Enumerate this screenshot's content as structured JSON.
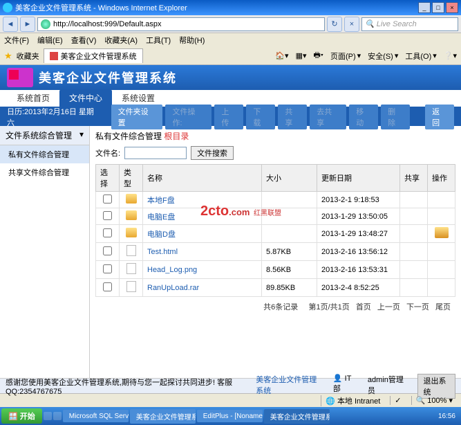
{
  "window": {
    "title": "美客企业文件管理系统 - Windows Internet Explorer",
    "url": "http://localhost:999/Default.aspx",
    "search_placeholder": "Live Search"
  },
  "ie_menu": [
    "文件(F)",
    "编辑(E)",
    "查看(V)",
    "收藏夹(A)",
    "工具(T)",
    "帮助(H)"
  ],
  "fav": {
    "label": "收藏夹",
    "tab": "美客企业文件管理系统",
    "right": [
      "",
      "页面(P)",
      "安全(S)",
      "工具(O)",
      ""
    ]
  },
  "app": {
    "title": "美客企业文件管理系统",
    "nav": [
      "系统首页",
      "文件中心",
      "系统设置"
    ],
    "nav_active": 1,
    "date": "日历:2013年2月16日 星期六",
    "actions": [
      "文件夹设置",
      "文件操作:",
      "上传",
      "下载",
      "共享",
      "去共享",
      "移动",
      "删除",
      "返回"
    ]
  },
  "sidebar": {
    "head": "文件系统综合管理",
    "items": [
      "私有文件综合管理",
      "共享文件综合管理"
    ],
    "sel": 0
  },
  "panel": {
    "title_a": "私有文件综合管理 ",
    "title_b": "根目录",
    "search_label": "文件名:",
    "search_btn": "文件搜索"
  },
  "table": {
    "cols": [
      "选择",
      "类型",
      "名称",
      "大小",
      "更新日期",
      "共享",
      "操作"
    ],
    "rows": [
      {
        "type": "folder",
        "name": "本地F盘",
        "size": "",
        "date": "2013-2-1 9:18:53",
        "share": "",
        "op": ""
      },
      {
        "type": "folder",
        "name": "电脑E盘",
        "size": "",
        "date": "2013-1-29 13:50:05",
        "share": "",
        "op": ""
      },
      {
        "type": "folder",
        "name": "电脑D盘",
        "size": "",
        "date": "2013-1-29 13:48:27",
        "share": "",
        "op": "open"
      },
      {
        "type": "file",
        "name": "Test.html",
        "size": "5.87KB",
        "date": "2013-2-16 13:56:12",
        "share": "",
        "op": ""
      },
      {
        "type": "file",
        "name": "Head_Log.png",
        "size": "8.56KB",
        "date": "2013-2-16 13:53:31",
        "share": "",
        "op": ""
      },
      {
        "type": "file",
        "name": "RanUpLoad.rar",
        "size": "89.85KB",
        "date": "2013-2-4 8:52:25",
        "share": "",
        "op": ""
      }
    ]
  },
  "watermark": {
    "a": "2cto",
    "b": ".com",
    "c": "红黑联盟"
  },
  "pager": {
    "total": "共6条记录",
    "pages": "第1页/共1页",
    "links": [
      "首页",
      "上一页",
      "下一页",
      "尾页"
    ]
  },
  "footer": {
    "thanks": "感谢您使用美客企业文件管理系统,期待与您一起探讨共同进步! 客服QQ:2354767675",
    "center": "美客企业文件管理系统",
    "dept": "IT部",
    "user": "admin管理员",
    "logout": "退出系统"
  },
  "status": {
    "zone": "本地 Intranet",
    "zoom": "100%"
  },
  "taskbar": {
    "start": "开始",
    "items": [
      "",
      "Microsoft SQL Serve…",
      "美客企业文件管理系…",
      "EditPlus - [Noname1…",
      "美客企业文件管理系…"
    ],
    "active": 4,
    "time": "16:56"
  }
}
